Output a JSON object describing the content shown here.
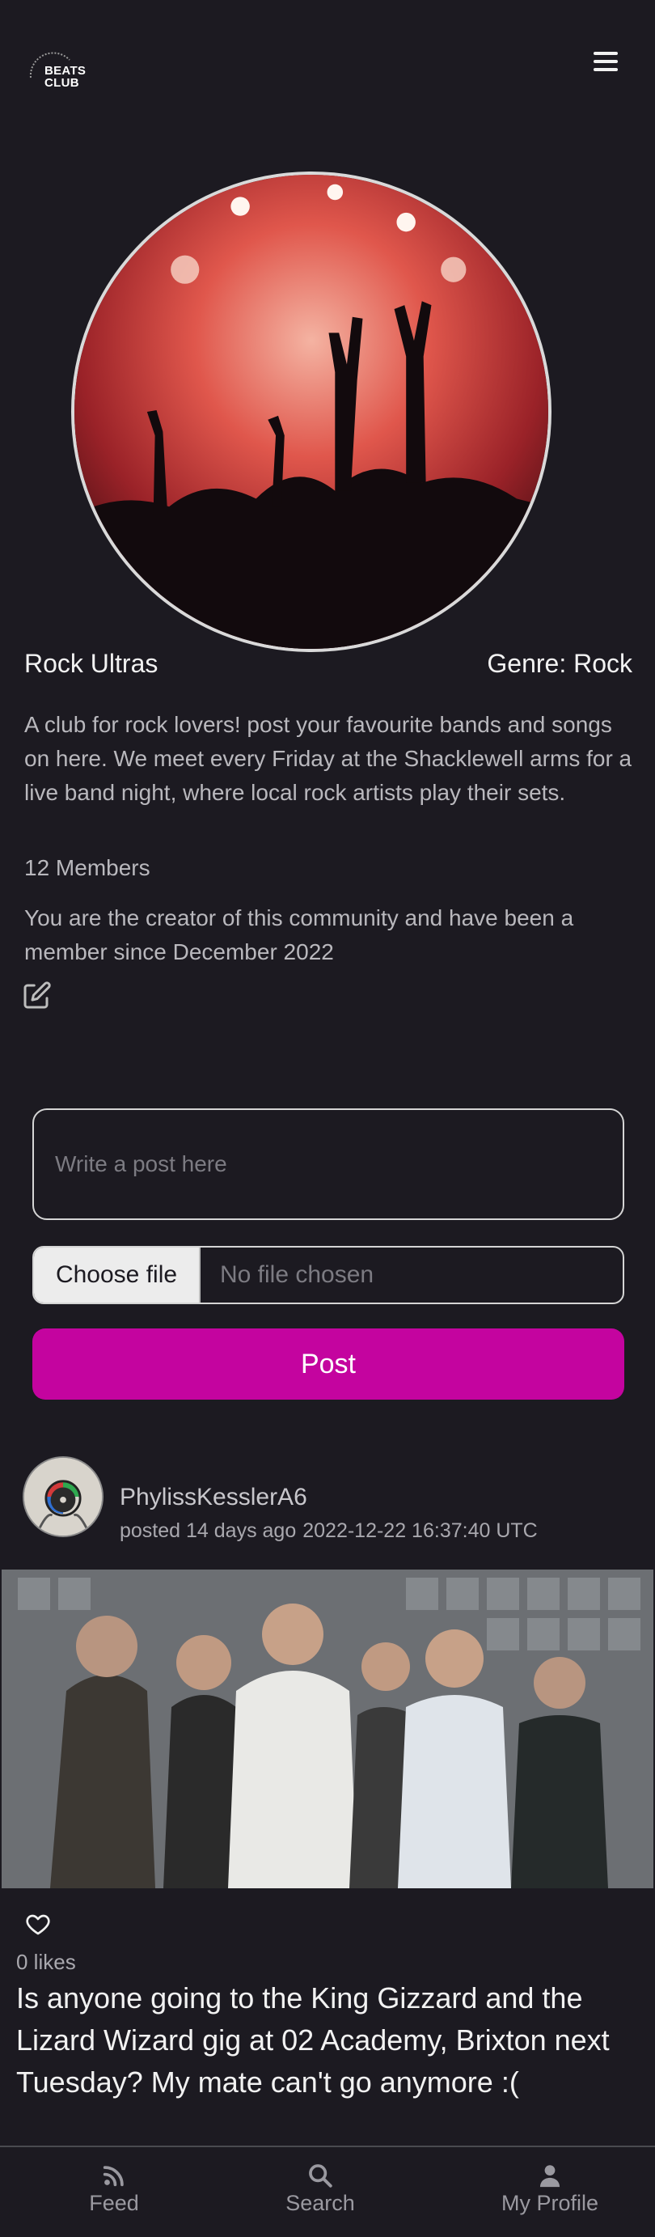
{
  "header": {
    "logo_text_line1": "BEATS",
    "logo_text_line2": "CLUB",
    "logo_arc_text": "SHARING MUSIC AROUND THE WORLD",
    "menu_icon": "hamburger-menu-icon"
  },
  "community": {
    "name": "Rock Ultras",
    "genre": "Genre: Rock",
    "description": "A club for rock lovers! post your favourite bands and songs on here. We meet every Friday at the Shacklewell arms for a live band night, where local rock artists play their sets.",
    "members": "12 Members",
    "creator_note": "You are the creator of this community and have been a member since December 2022",
    "edit_icon": "edit-pencil-icon"
  },
  "composer": {
    "placeholder": "Write a post here",
    "file_button": "Choose file",
    "file_status": "No file chosen",
    "post_button": "Post"
  },
  "post": {
    "author": "PhylissKesslerA6",
    "posted_ago": "posted 14 days ago",
    "timestamp": "2022-12-22 16:37:40 UTC",
    "likes": "0 likes",
    "text": "Is anyone going to the King Gizzard and the Lizard Wizard gig at 02 Academy, Brixton next Tuesday? My mate can't go anymore :("
  },
  "nav": {
    "feed": "Feed",
    "search": "Search",
    "profile": "My Profile"
  },
  "colors": {
    "background": "#1c1a21",
    "accent": "#c4049f"
  }
}
